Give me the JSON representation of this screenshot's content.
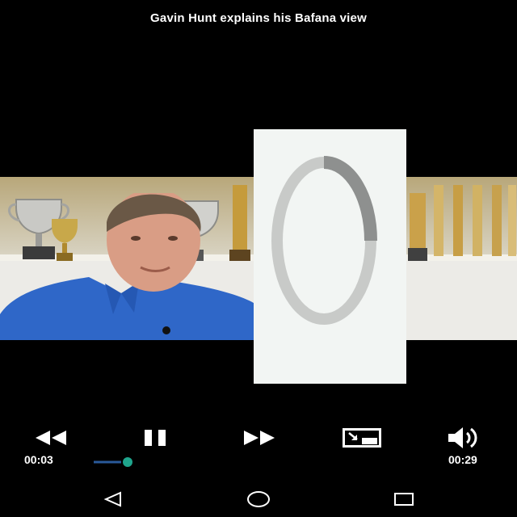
{
  "video": {
    "title": "Gavin Hunt explains his Bafana view"
  },
  "player": {
    "current_time": "00:03",
    "duration": "00:29",
    "progress_fraction": 0.1,
    "loading": true,
    "accent_color": "#1fa58d",
    "track_color": "#2a5a9a"
  },
  "controls": {
    "rewind_icon": "rewind-icon",
    "pause_icon": "pause-icon",
    "fast_forward_icon": "fast-forward-icon",
    "picture_in_picture_icon": "picture-in-picture-icon",
    "volume_icon": "volume-icon"
  },
  "navbar": {
    "back_icon": "triangle-back-icon",
    "home_icon": "circle-home-icon",
    "recents_icon": "square-recents-icon"
  }
}
